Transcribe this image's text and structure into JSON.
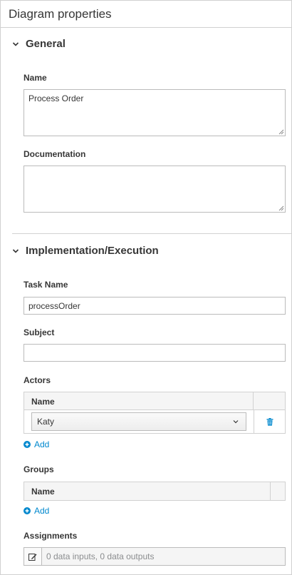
{
  "panel": {
    "title": "Diagram properties"
  },
  "general": {
    "section_label": "General",
    "name_label": "Name",
    "name_value": "Process Order",
    "documentation_label": "Documentation",
    "documentation_value": ""
  },
  "implementation": {
    "section_label": "Implementation/Execution",
    "task_name_label": "Task Name",
    "task_name_value": "processOrder",
    "subject_label": "Subject",
    "subject_value": "",
    "actors": {
      "label": "Actors",
      "column_name": "Name",
      "rows": [
        {
          "value": "Katy"
        }
      ],
      "add_label": "Add"
    },
    "groups": {
      "label": "Groups",
      "column_name": "Name",
      "add_label": "Add"
    },
    "assignments": {
      "label": "Assignments",
      "value": "0 data inputs, 0 data outputs"
    }
  },
  "colors": {
    "link": "#0088ce",
    "text": "#363636",
    "border": "#d1d1d1"
  },
  "icons": [
    "chevron-down-icon",
    "trash-icon",
    "plus-circle-icon",
    "edit-icon"
  ]
}
